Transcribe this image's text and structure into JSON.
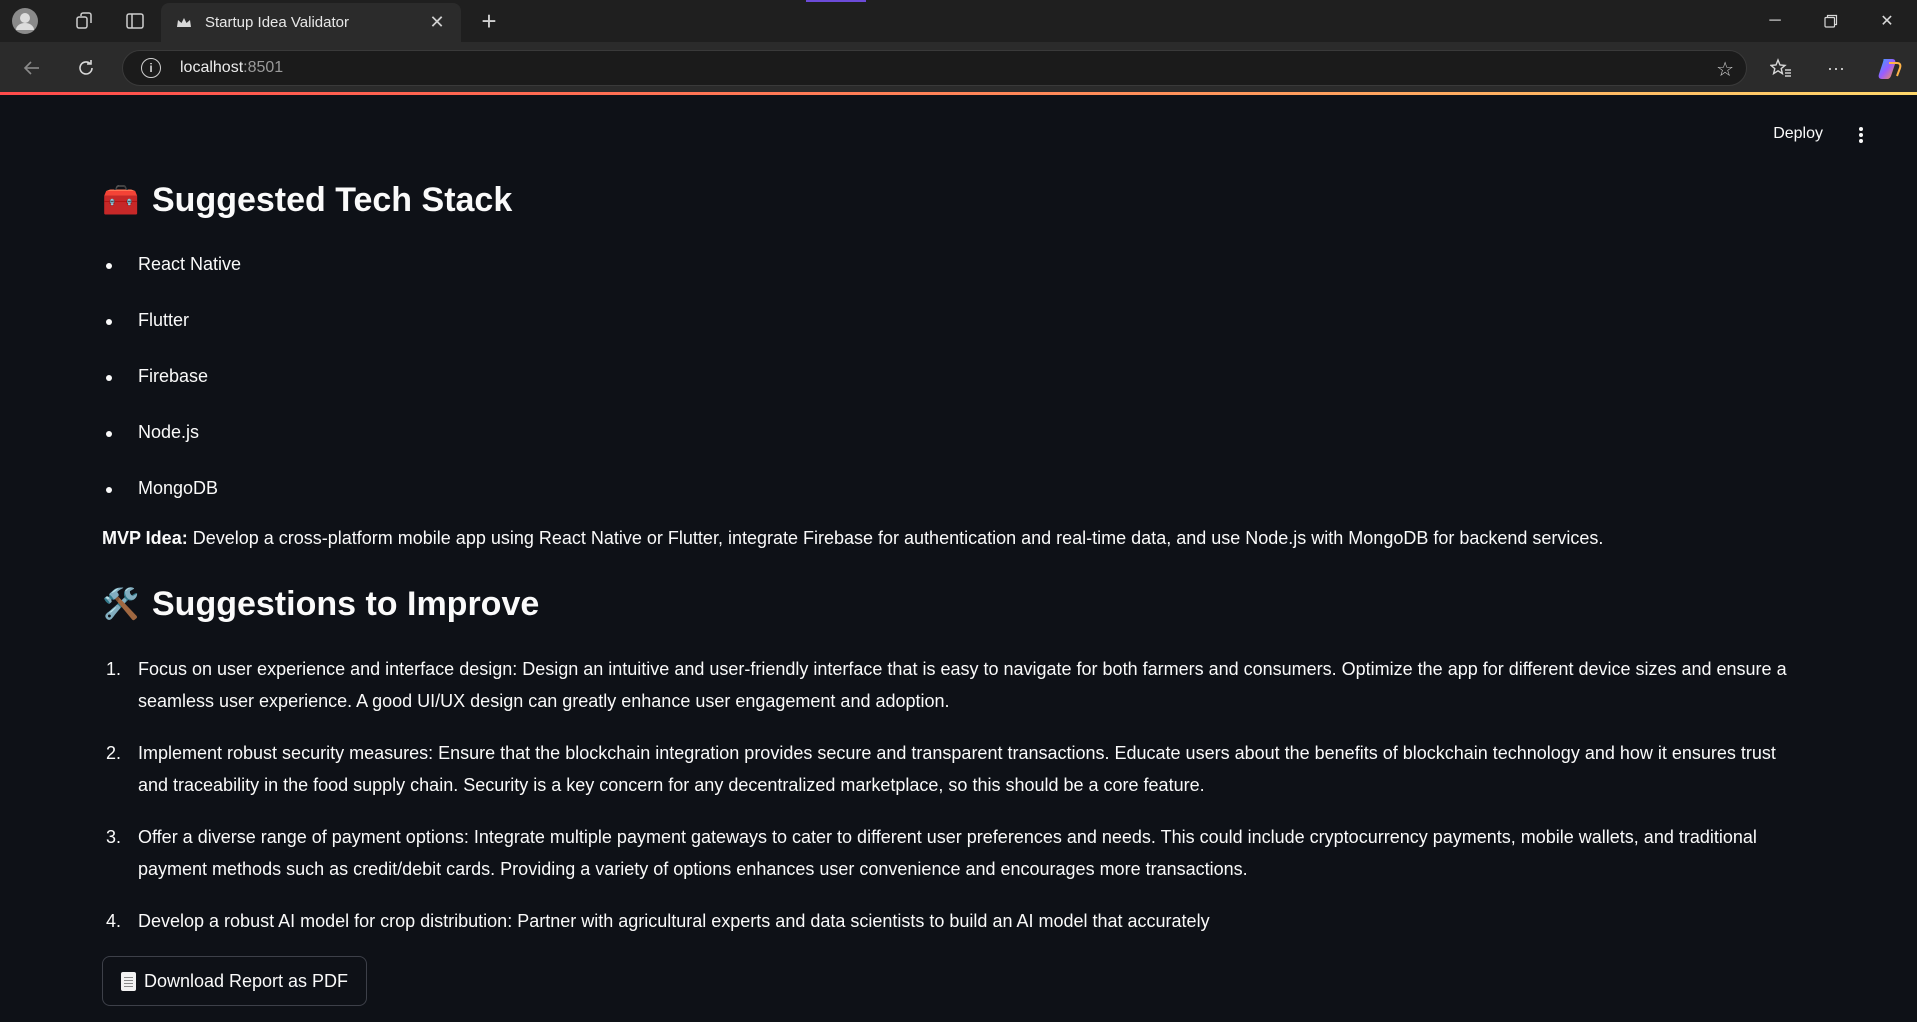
{
  "browser": {
    "tab_title": "Startup Idea Validator",
    "url_host": "localhost",
    "url_port": ":8501"
  },
  "header": {
    "deploy_label": "Deploy"
  },
  "tech_stack": {
    "heading": "Suggested Tech Stack",
    "emoji": "🧰",
    "items": [
      "React Native",
      "Flutter",
      "Firebase",
      "Node.js",
      "MongoDB"
    ]
  },
  "mvp": {
    "label": "MVP Idea:",
    "text": " Develop a cross-platform mobile app using React Native or Flutter, integrate Firebase for authentication and real-time data, and use Node.js with MongoDB for backend services."
  },
  "suggestions": {
    "heading": "Suggestions to Improve",
    "emoji": "🛠️",
    "items": [
      {
        "num": "1.",
        "text": "Focus on user experience and interface design: Design an intuitive and user-friendly interface that is easy to navigate for both farmers and consumers. Optimize the app for different device sizes and ensure a seamless user experience. A good UI/UX design can greatly enhance user engagement and adoption."
      },
      {
        "num": "2.",
        "text": "Implement robust security measures: Ensure that the blockchain integration provides secure and transparent transactions. Educate users about the benefits of blockchain technology and how it ensures trust and traceability in the food supply chain. Security is a key concern for any decentralized marketplace, so this should be a core feature."
      },
      {
        "num": "3.",
        "text": "Offer a diverse range of payment options: Integrate multiple payment gateways to cater to different user preferences and needs. This could include cryptocurrency payments, mobile wallets, and traditional payment methods such as credit/debit cards. Providing a variety of options enhances user convenience and encourages more transactions."
      },
      {
        "num": "4.",
        "text": "Develop a robust AI model for crop distribution: Partner with agricultural experts and data scientists to build an AI model that accurately"
      }
    ]
  },
  "download": {
    "label": "Download Report as PDF"
  }
}
